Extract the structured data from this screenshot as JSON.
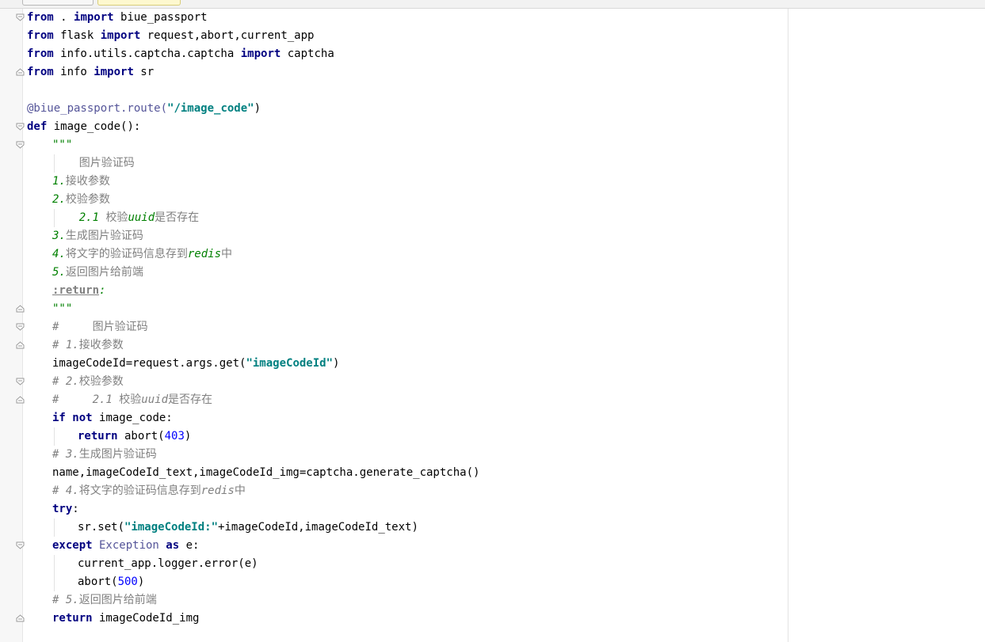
{
  "editor": {
    "lines": [
      {
        "fold": "start",
        "indent": 0,
        "segments": [
          {
            "t": "from",
            "c": "kw"
          },
          {
            "t": " . ",
            "c": ""
          },
          {
            "t": "import",
            "c": "kw"
          },
          {
            "t": " biue_passport",
            "c": ""
          }
        ]
      },
      {
        "indent": 0,
        "segments": [
          {
            "t": "from",
            "c": "kw"
          },
          {
            "t": " flask ",
            "c": ""
          },
          {
            "t": "import",
            "c": "kw"
          },
          {
            "t": " request,abort,current_app",
            "c": ""
          }
        ]
      },
      {
        "indent": 0,
        "segments": [
          {
            "t": "from",
            "c": "kw"
          },
          {
            "t": " info.utils.captcha.captcha ",
            "c": ""
          },
          {
            "t": "import",
            "c": "kw"
          },
          {
            "t": " captcha",
            "c": ""
          }
        ]
      },
      {
        "fold": "end",
        "indent": 0,
        "segments": [
          {
            "t": "from",
            "c": "kw"
          },
          {
            "t": " info ",
            "c": ""
          },
          {
            "t": "import",
            "c": "kw"
          },
          {
            "t": " sr",
            "c": ""
          }
        ]
      },
      {
        "indent": 0,
        "segments": []
      },
      {
        "indent": 0,
        "segments": [
          {
            "t": "@biue_passport.route(",
            "c": "dec"
          },
          {
            "t": "\"/image_code\"",
            "c": "str"
          },
          {
            "t": ")",
            "c": ""
          }
        ]
      },
      {
        "fold": "start",
        "indent": 0,
        "segments": [
          {
            "t": "def",
            "c": "kw"
          },
          {
            "t": " image_code():",
            "c": ""
          }
        ]
      },
      {
        "fold": "start",
        "indent": 1,
        "segments": [
          {
            "t": "\"\"\"",
            "c": "docstr"
          }
        ]
      },
      {
        "indent": 1,
        "guides": [
          1
        ],
        "segments": [
          {
            "t": "    图片验证码",
            "c": "doc"
          }
        ]
      },
      {
        "indent": 1,
        "segments": [
          {
            "t": "1.",
            "c": "docstr"
          },
          {
            "t": "接收参数",
            "c": "doc"
          }
        ]
      },
      {
        "indent": 1,
        "segments": [
          {
            "t": "2.",
            "c": "docstr"
          },
          {
            "t": "校验参数",
            "c": "doc"
          }
        ]
      },
      {
        "indent": 1,
        "guides": [
          1
        ],
        "segments": [
          {
            "t": "    2.1 ",
            "c": "docstr"
          },
          {
            "t": "校验",
            "c": "doc"
          },
          {
            "t": "uuid",
            "c": "docstr"
          },
          {
            "t": "是否存在",
            "c": "doc"
          }
        ]
      },
      {
        "indent": 1,
        "segments": [
          {
            "t": "3.",
            "c": "docstr"
          },
          {
            "t": "生成图片验证码",
            "c": "doc"
          }
        ]
      },
      {
        "indent": 1,
        "segments": [
          {
            "t": "4.",
            "c": "docstr"
          },
          {
            "t": "将文字的验证码信息存到",
            "c": "doc"
          },
          {
            "t": "redis",
            "c": "docstr"
          },
          {
            "t": "中",
            "c": "doc"
          }
        ]
      },
      {
        "indent": 1,
        "segments": [
          {
            "t": "5.",
            "c": "docstr"
          },
          {
            "t": "返回图片给前端",
            "c": "doc"
          }
        ]
      },
      {
        "indent": 1,
        "segments": [
          {
            "t": ":return",
            "c": "doctag"
          },
          {
            "t": ":",
            "c": "docstr"
          }
        ]
      },
      {
        "fold": "end",
        "indent": 1,
        "segments": [
          {
            "t": "\"\"\"",
            "c": "docstr"
          }
        ]
      },
      {
        "fold": "start",
        "indent": 1,
        "segments": [
          {
            "t": "#     ",
            "c": "cmt"
          },
          {
            "t": "图片验证码",
            "c": "cmt cjk"
          }
        ]
      },
      {
        "fold": "end",
        "indent": 1,
        "segments": [
          {
            "t": "# 1.",
            "c": "cmt"
          },
          {
            "t": "接收参数",
            "c": "cmt cjk"
          }
        ]
      },
      {
        "indent": 1,
        "segments": [
          {
            "t": "imageCodeId=request.args.get(",
            "c": ""
          },
          {
            "t": "\"imageCodeId\"",
            "c": "str"
          },
          {
            "t": ")",
            "c": ""
          }
        ]
      },
      {
        "fold": "start",
        "indent": 1,
        "segments": [
          {
            "t": "# 2.",
            "c": "cmt"
          },
          {
            "t": "校验参数",
            "c": "cmt cjk"
          }
        ]
      },
      {
        "fold": "end",
        "indent": 1,
        "segments": [
          {
            "t": "#     2.1 ",
            "c": "cmt"
          },
          {
            "t": "校验",
            "c": "cmt cjk"
          },
          {
            "t": "uuid",
            "c": "cmt"
          },
          {
            "t": "是否存在",
            "c": "cmt cjk"
          }
        ]
      },
      {
        "indent": 1,
        "segments": [
          {
            "t": "if",
            "c": "kw"
          },
          {
            "t": " ",
            "c": ""
          },
          {
            "t": "not",
            "c": "kw"
          },
          {
            "t": " image_code:",
            "c": ""
          }
        ]
      },
      {
        "indent": 2,
        "guides": [
          1
        ],
        "segments": [
          {
            "t": "return",
            "c": "kw"
          },
          {
            "t": " abort(",
            "c": ""
          },
          {
            "t": "403",
            "c": "num"
          },
          {
            "t": ")",
            "c": ""
          }
        ]
      },
      {
        "indent": 1,
        "segments": [
          {
            "t": "# 3.",
            "c": "cmt"
          },
          {
            "t": "生成图片验证码",
            "c": "cmt cjk"
          }
        ]
      },
      {
        "indent": 1,
        "segments": [
          {
            "t": "name,imageCodeId_text,imageCodeId_img=captcha.generate_captcha()",
            "c": ""
          }
        ]
      },
      {
        "indent": 1,
        "segments": [
          {
            "t": "# 4.",
            "c": "cmt"
          },
          {
            "t": "将文字的验证码信息存到",
            "c": "cmt cjk"
          },
          {
            "t": "redis",
            "c": "cmt"
          },
          {
            "t": "中",
            "c": "cmt cjk"
          }
        ]
      },
      {
        "indent": 1,
        "segments": [
          {
            "t": "try",
            "c": "kw"
          },
          {
            "t": ":",
            "c": ""
          }
        ]
      },
      {
        "indent": 2,
        "guides": [
          1
        ],
        "segments": [
          {
            "t": "sr.set(",
            "c": ""
          },
          {
            "t": "\"imageCodeId:\"",
            "c": "str"
          },
          {
            "t": "+imageCodeId,imageCodeId_text)",
            "c": ""
          }
        ]
      },
      {
        "fold": "start",
        "indent": 1,
        "segments": [
          {
            "t": "except",
            "c": "kw"
          },
          {
            "t": " Exception ",
            "c": "dec"
          },
          {
            "t": "as",
            "c": "kw"
          },
          {
            "t": " e:",
            "c": ""
          }
        ]
      },
      {
        "indent": 2,
        "guides": [
          1
        ],
        "segments": [
          {
            "t": "current_app.logger.error(e)",
            "c": ""
          }
        ]
      },
      {
        "indent": 2,
        "guides": [
          1
        ],
        "segments": [
          {
            "t": "abort(",
            "c": ""
          },
          {
            "t": "500",
            "c": "num"
          },
          {
            "t": ")",
            "c": ""
          }
        ]
      },
      {
        "indent": 1,
        "segments": [
          {
            "t": "# 5.",
            "c": "cmt"
          },
          {
            "t": "返回图片给前端",
            "c": "cmt cjk"
          }
        ]
      },
      {
        "fold": "end",
        "indent": 1,
        "segments": [
          {
            "t": "return",
            "c": "kw"
          },
          {
            "t": " imageCodeId_img",
            "c": ""
          }
        ]
      }
    ]
  }
}
